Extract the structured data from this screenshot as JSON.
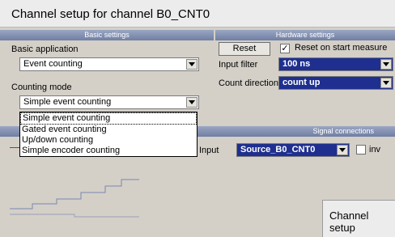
{
  "window": {
    "title": "Channel setup for channel B0_CNT0"
  },
  "sections": {
    "basic": "Basic settings",
    "hardware": "Hardware settings",
    "signal": "Signal connections"
  },
  "basic": {
    "application_label": "Basic application",
    "application_value": "Event counting",
    "mode_label": "Counting mode",
    "mode_value": "Simple event counting",
    "mode_options": [
      "Simple event counting",
      "Gated event counting",
      "Up/down counting",
      "Simple encoder counting"
    ]
  },
  "hardware": {
    "reset_label": "Reset",
    "reset_on_start_label": "Reset on start measure",
    "reset_on_start_checked": true,
    "input_filter_label": "Input filter",
    "input_filter_value": "100 ns",
    "count_direction_label": "Count direction",
    "count_direction_value": "count up"
  },
  "signal": {
    "input_label": "Input",
    "input_value": "Source_B0_CNT0",
    "inv_label": "inv",
    "inv_checked": false
  },
  "subwindow": {
    "title": "Channel setup"
  }
}
